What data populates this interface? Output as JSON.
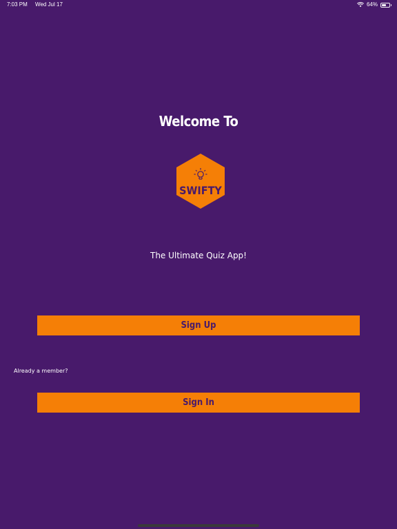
{
  "status_bar": {
    "time": "7:03 PM",
    "date": "Wed Jul 17",
    "battery_percent": "64%",
    "battery_level": 0.64,
    "wifi_icon": "wifi-icon",
    "battery_icon": "battery-icon"
  },
  "welcome": {
    "title": "Welcome To"
  },
  "logo": {
    "text": "SWIFTY",
    "icon": "lightbulb-icon",
    "color": "#f57f06"
  },
  "tagline": "The Ultimate Quiz App!",
  "buttons": {
    "signup_label": "Sign Up",
    "signin_label": "Sign In"
  },
  "already_member": "Already a member?",
  "colors": {
    "background": "#481a6b",
    "accent": "#f57f06",
    "text": "#ffffff"
  }
}
